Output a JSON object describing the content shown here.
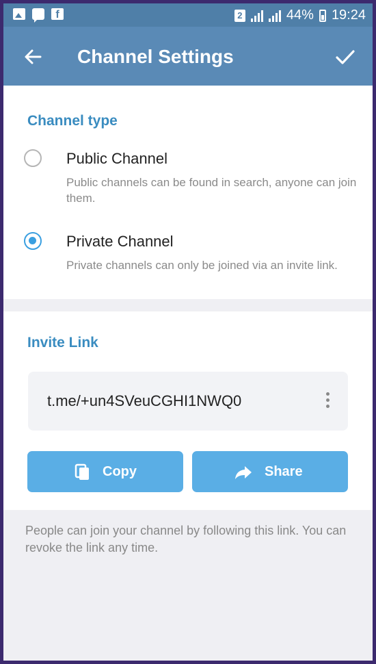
{
  "status_bar": {
    "left_icons": [
      "image-icon",
      "message-icon",
      "facebook-icon"
    ],
    "sim_badge": "2",
    "battery_text": "44%",
    "time": "19:24"
  },
  "app_bar": {
    "title": "Channel Settings",
    "back_icon": "arrow-left-icon",
    "confirm_icon": "check-icon"
  },
  "channel_type": {
    "header": "Channel type",
    "options": [
      {
        "label": "Public Channel",
        "description": "Public channels can be found in search, anyone can join them.",
        "selected": false
      },
      {
        "label": "Private Channel",
        "description": "Private channels can only be joined via an invite link.",
        "selected": true
      }
    ]
  },
  "invite_link": {
    "header": "Invite Link",
    "link": "t.me/+un4SVeuCGHI1NWQ0",
    "copy_label": "Copy",
    "share_label": "Share",
    "footer": "People can join your channel by following this link. You can revoke the link any time."
  },
  "colors": {
    "status_bar": "#4f7fa8",
    "app_bar": "#5a8ab6",
    "accent": "#3a9fe0",
    "button": "#5aaee5"
  }
}
